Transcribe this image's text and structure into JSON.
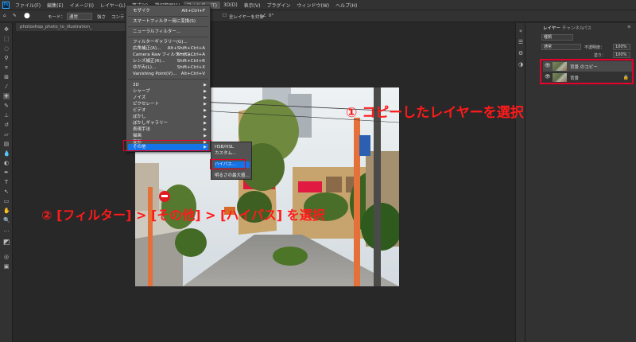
{
  "menubar": {
    "logo": "Ps",
    "items": [
      "ファイル(F)",
      "編集(E)",
      "イメージ(I)",
      "レイヤー(L)",
      "書式(Y)",
      "選択範囲(S)",
      "フィルター(T)",
      "3D(D)",
      "表示(V)",
      "プラグイン",
      "ウィンドウ(W)",
      "ヘルプ(H)"
    ]
  },
  "optbar": {
    "mode_label": "モード：",
    "mode_value": "通常",
    "opacity_label": "不透明度：",
    "flow_label": "強さ",
    "sample_label": "コンテ",
    "all_layers": "全レイヤーを対象",
    "angle": "0°"
  },
  "document": {
    "tab_title": "photoshop_photo_to_illustration_"
  },
  "filter_menu": {
    "items": [
      {
        "label": "モザイク",
        "shortcut": "Alt+Ctrl+F"
      },
      {
        "label": "スマートフィルター用に変換(S)",
        "shortcut": ""
      },
      {
        "label": "ニューラルフィルター...",
        "shortcut": ""
      },
      {
        "label": "フィルターギャラリー(G)...",
        "shortcut": ""
      },
      {
        "label": "広角補正(A)...",
        "shortcut": "Alt+Shift+Ctrl+A"
      },
      {
        "label": "Camera Raw フィルター(C)...",
        "shortcut": "Shift+Ctrl+A"
      },
      {
        "label": "レンズ補正(R)...",
        "shortcut": "Shift+Ctrl+R"
      },
      {
        "label": "ゆがみ(L)...",
        "shortcut": "Shift+Ctrl+X"
      },
      {
        "label": "Vanishing Point(V)...",
        "shortcut": "Alt+Ctrl+V"
      },
      {
        "label": "3D",
        "shortcut": ""
      },
      {
        "label": "シャープ",
        "shortcut": ""
      },
      {
        "label": "ノイズ",
        "shortcut": ""
      },
      {
        "label": "ピクセレート",
        "shortcut": ""
      },
      {
        "label": "ビデオ",
        "shortcut": ""
      },
      {
        "label": "ぼかし",
        "shortcut": ""
      },
      {
        "label": "ぼかしギャラリー",
        "shortcut": ""
      },
      {
        "label": "表現手法",
        "shortcut": ""
      },
      {
        "label": "描画",
        "shortcut": ""
      },
      {
        "label": "変形",
        "shortcut": ""
      },
      {
        "label": "その他",
        "shortcut": ""
      }
    ]
  },
  "other_submenu": {
    "items": [
      "HSB/HSL",
      "カスタム...",
      "ハイパス...",
      "明るさの最大値..."
    ]
  },
  "panel": {
    "tabs": [
      "レイヤー",
      "チャンネル",
      "パス"
    ],
    "kind_label": "種類",
    "blend": "通常",
    "opacity_label": "不透明度：",
    "opacity": "100%",
    "fill_label": "塗り：",
    "fill": "100%",
    "layers": [
      {
        "name": "背景 のコピー"
      },
      {
        "name": "背景"
      }
    ]
  },
  "annotations": {
    "step1": "① コピーしたレイヤーを選択",
    "step2": "② [フィルター] > [その他] > [ハイパス] を選択"
  },
  "colors": {
    "highlight": "#1473e6",
    "annotation": "#ff1a1a"
  }
}
